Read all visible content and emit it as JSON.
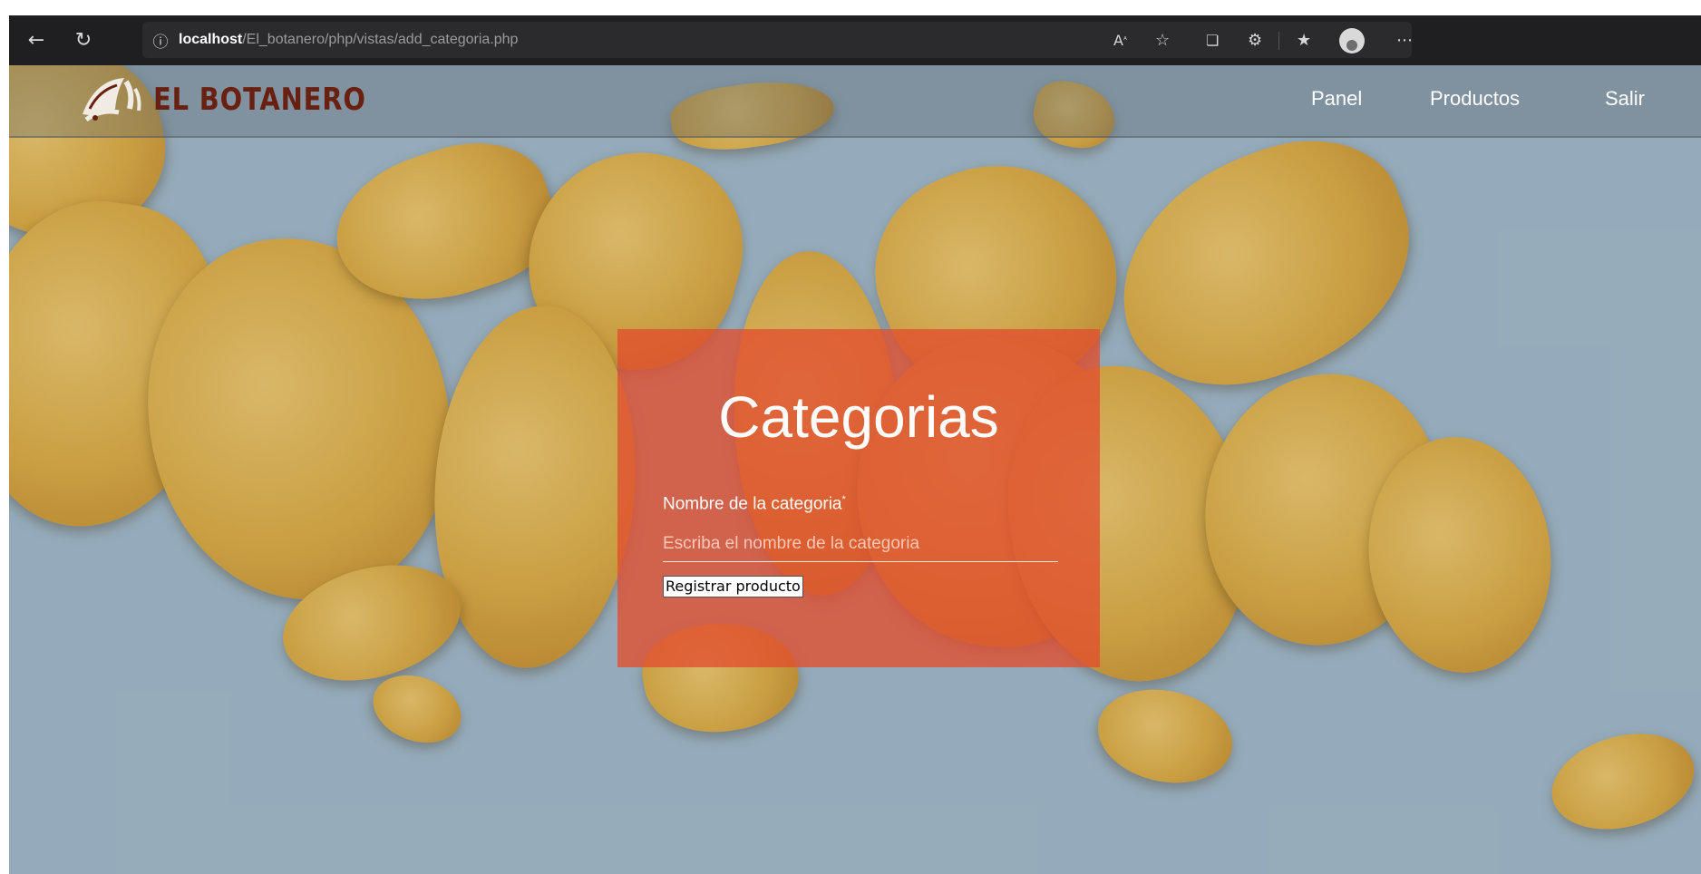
{
  "browser": {
    "url_host": "localhost",
    "url_path": "/El_botanero/php/vistas/add_categoria.php",
    "icons": [
      "back-arrow-icon",
      "refresh-icon",
      "info-icon",
      "read-aloud-icon",
      "add-favorite-icon",
      "tab-actions-icon",
      "extensions-icon",
      "favorites-icon",
      "profile-icon",
      "more-icon"
    ]
  },
  "navbar": {
    "brand": "EL BOTANERO",
    "links": [
      "Panel",
      "Productos",
      "Salir"
    ]
  },
  "form": {
    "title": "Categorias",
    "label": "Nombre de la categoria",
    "required_mark": "*",
    "placeholder": "Escriba el nombre de la categoria",
    "value": "",
    "submit_label": "Registrar producto"
  },
  "colors": {
    "panel": "#e24e2e",
    "brand_text": "#6a2010",
    "background": "#9fb6c6",
    "browser_bar": "#1f1f22"
  }
}
